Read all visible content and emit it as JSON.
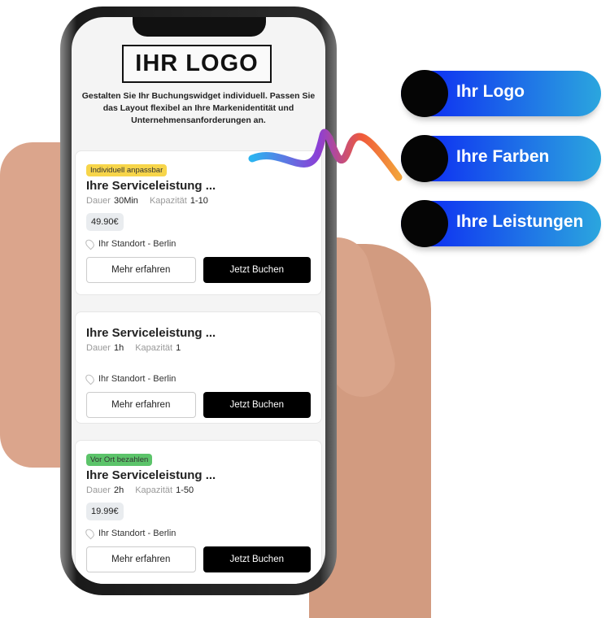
{
  "header": {
    "logo_text": "IHR LOGO",
    "intro": "Gestalten Sie Ihr Buchungswidget individuell. Passen Sie das Layout flexibel an Ihre Markenidentität und Unternehmensanforderungen an."
  },
  "cards": [
    {
      "badge": "Individuell anpassbar",
      "badge_color": "#f7d54a",
      "title": "Ihre Serviceleistung ...",
      "duration_label": "Dauer",
      "duration": "30Min",
      "capacity_label": "Kapazität",
      "capacity": "1-10",
      "price": "49.90€",
      "location": "Ihr Standort - Berlin",
      "more": "Mehr erfahren",
      "book": "Jetzt Buchen"
    },
    {
      "title": "Ihre Serviceleistung ...",
      "duration_label": "Dauer",
      "duration": "1h",
      "capacity_label": "Kapazität",
      "capacity": "1",
      "location": "Ihr Standort - Berlin",
      "more": "Mehr erfahren",
      "book": "Jetzt Buchen"
    },
    {
      "badge": "Vor Ort bezahlen",
      "badge_color": "#5cc46a",
      "title": "Ihre Serviceleistung ...",
      "duration_label": "Dauer",
      "duration": "2h",
      "capacity_label": "Kapazität",
      "capacity": "1-50",
      "price": "19.99€",
      "location": "Ihr Standort - Berlin",
      "more": "Mehr erfahren",
      "book": "Jetzt Buchen"
    }
  ],
  "features": [
    "Ihr Logo",
    "Ihre Farben",
    "Ihre Leistungen"
  ],
  "colors": {
    "pill_start": "#0a1ff5",
    "pill_end": "#2ba6de"
  }
}
